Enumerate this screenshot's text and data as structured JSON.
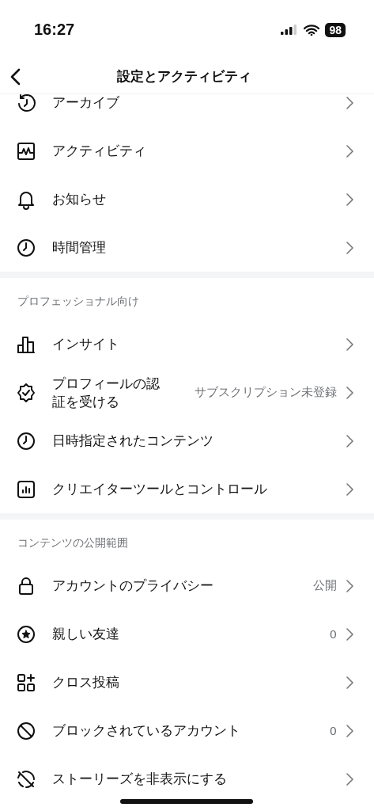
{
  "status_bar": {
    "time": "16:27",
    "battery": "98"
  },
  "header": {
    "title": "設定とアクティビティ"
  },
  "sections": [
    {
      "items": [
        {
          "label": "アーカイブ"
        },
        {
          "label": "アクティビティ"
        },
        {
          "label": "お知らせ"
        },
        {
          "label": "時間管理"
        }
      ]
    },
    {
      "title": "プロフェッショナル向け",
      "items": [
        {
          "label": "インサイト"
        },
        {
          "label": "プロフィールの認証を受ける",
          "value": "サブスクリプション未登録"
        },
        {
          "label": "日時指定されたコンテンツ"
        },
        {
          "label": "クリエイターツールとコントロール"
        }
      ]
    },
    {
      "title": "コンテンツの公開範囲",
      "items": [
        {
          "label": "アカウントのプライバシー",
          "value": "公開"
        },
        {
          "label": "親しい友達",
          "value": "0"
        },
        {
          "label": "クロス投稿"
        },
        {
          "label": "ブロックされているアカウント",
          "value": "0"
        },
        {
          "label": "ストーリーズを非表示にする"
        }
      ]
    }
  ]
}
